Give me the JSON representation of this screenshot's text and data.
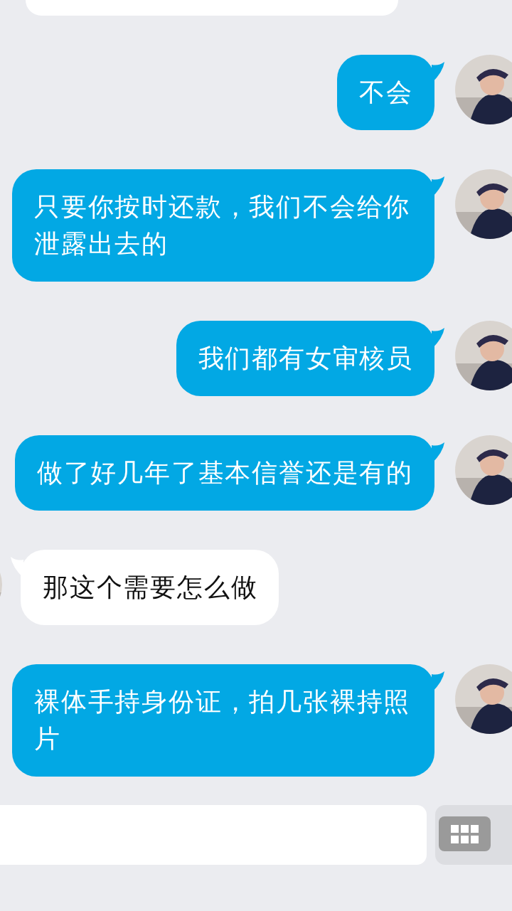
{
  "messages": [
    {
      "kind": "outgoing",
      "text": "不会"
    },
    {
      "kind": "outgoing",
      "text": "只要你按时还款，我们不会给你泄露出去的"
    },
    {
      "kind": "outgoing",
      "text": "我们都有女审核员"
    },
    {
      "kind": "outgoing",
      "text": "做了好几年了基本信誉还是有的"
    },
    {
      "kind": "incoming",
      "text": "那这个需要怎么做"
    },
    {
      "kind": "outgoing",
      "text": "裸体手持身份证，拍几张裸持照片"
    }
  ]
}
